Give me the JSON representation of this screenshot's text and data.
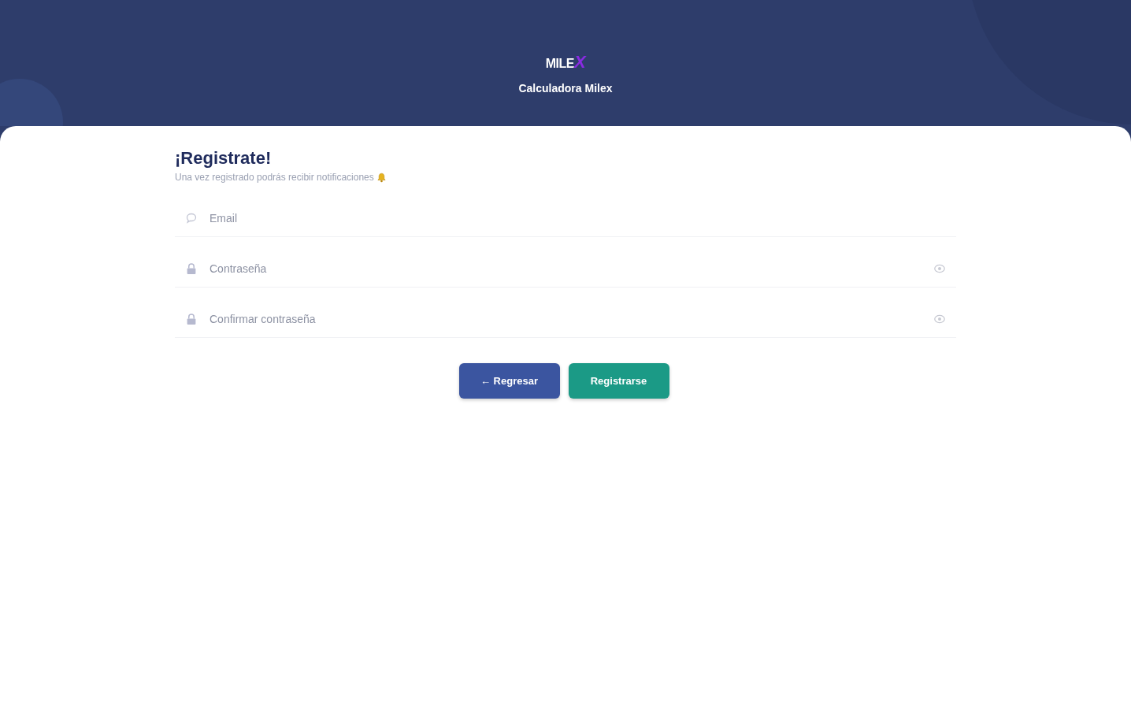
{
  "header": {
    "logo": {
      "wordmark": "MILE",
      "accent": "X"
    },
    "title": "Calculadora Milex"
  },
  "form": {
    "title": "¡Registrate!",
    "subtitle": "Una vez registrado podrás recibir notificaciones",
    "fields": [
      {
        "kind": "email",
        "placeholder": "Email"
      },
      {
        "kind": "password",
        "placeholder": "Contraseña"
      },
      {
        "kind": "password",
        "placeholder": "Confirmar contraseña"
      }
    ],
    "buttons": [
      {
        "kind": "back",
        "label": "← Regresar"
      },
      {
        "kind": "submit",
        "label": "Registrarse"
      }
    ]
  }
}
